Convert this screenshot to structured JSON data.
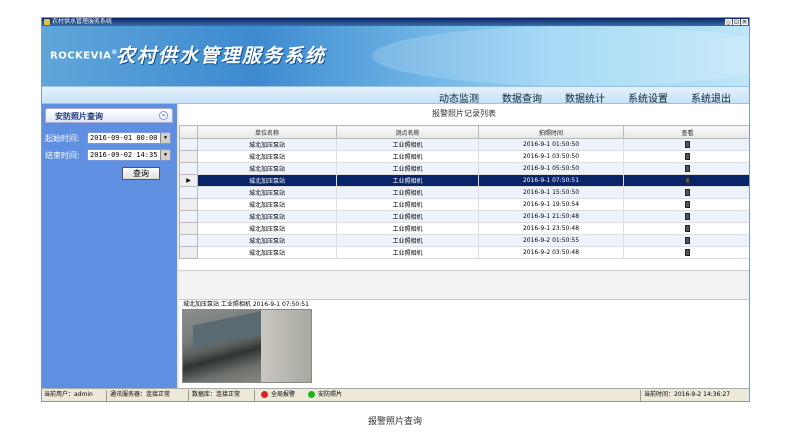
{
  "window": {
    "title": "农村供水管理服务系统",
    "btn_min": "_",
    "btn_max": "□",
    "btn_close": "×"
  },
  "banner": {
    "brand": "ROCKEVIA",
    "brand_mark": "®",
    "title": "农村供水管理服务系统"
  },
  "menu": {
    "items": [
      "动态监测",
      "数据查询",
      "数据统计",
      "系统设置",
      "系统退出"
    ]
  },
  "sidebar": {
    "panel_title": "安防照片查询",
    "collapse_glyph": "»",
    "start_label": "起始时间:",
    "start_value": "2016-09-01 00:00",
    "end_label": "结束时间:",
    "end_value": "2016-09-02 14:35",
    "query_button": "查询"
  },
  "list": {
    "title": "报警照片记录列表",
    "columns": [
      "单位名称",
      "测点名称",
      "拍照时间",
      "查看"
    ],
    "rows": [
      {
        "unit": "城北加压泵站",
        "point": "工业照相机",
        "time": "2016-9-1 01:50:50"
      },
      {
        "unit": "城北加压泵站",
        "point": "工业照相机",
        "time": "2016-9-1 03:50:50"
      },
      {
        "unit": "城北加压泵站",
        "point": "工业照相机",
        "time": "2016-9-1 05:50:50"
      },
      {
        "unit": "城北加压泵站",
        "point": "工业照相机",
        "time": "2016-9-1 07:50:51"
      },
      {
        "unit": "城北加压泵站",
        "point": "工业照相机",
        "time": "2016-9-1 15:50:50"
      },
      {
        "unit": "城北加压泵站",
        "point": "工业照相机",
        "time": "2016-9-1 19:50:54"
      },
      {
        "unit": "城北加压泵站",
        "point": "工业照相机",
        "time": "2016-9-1 21:50:48"
      },
      {
        "unit": "城北加压泵站",
        "point": "工业照相机",
        "time": "2016-9-1 23:50:48"
      },
      {
        "unit": "城北加压泵站",
        "point": "工业照相机",
        "time": "2016-9-2 01:50:55"
      },
      {
        "unit": "城北加压泵站",
        "point": "工业照相机",
        "time": "2016-9-2 03:50:48"
      }
    ],
    "selected_index": 3,
    "selected_marker": "▶"
  },
  "detail": {
    "caption": "城北加压泵站  工业照相机  2016-9-1 07:50:51"
  },
  "status": {
    "user": "当前用户：admin",
    "comm": "通讯服务器：连接正常",
    "db": "数据库：连接正常",
    "alarm": "全局报警",
    "photo": "安防照片",
    "time": "当前时间：2016-9-2 14:36:27",
    "alarm_color": "#e02020",
    "photo_color": "#20b020"
  },
  "caption": "报警照片查询"
}
